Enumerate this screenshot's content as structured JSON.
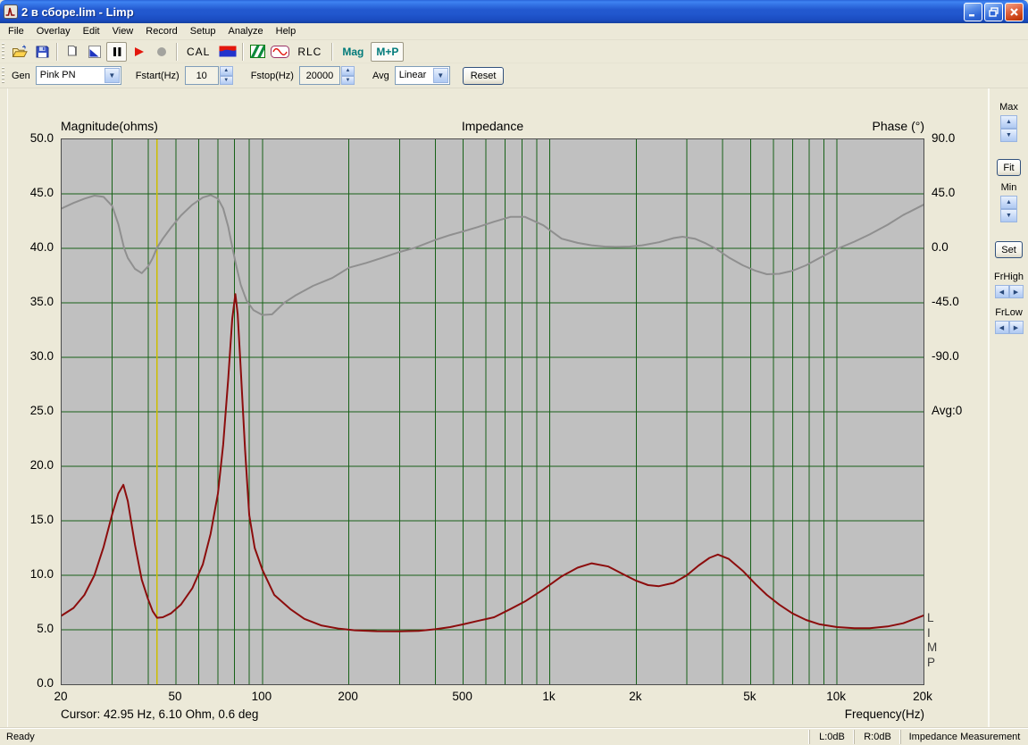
{
  "window": {
    "title": "2 в сборе.lim - Limp"
  },
  "menu": {
    "items": [
      "File",
      "Overlay",
      "Edit",
      "View",
      "Record",
      "Setup",
      "Analyze",
      "Help"
    ]
  },
  "toolbar": {
    "open": "open",
    "save": "save",
    "copy": "copy",
    "overlay_color": "overlay-color",
    "pause": "pause",
    "play": "play",
    "record": "record",
    "cal_label": "CAL",
    "rlc_label": "RLC",
    "mag_label": "Mag",
    "mp_label": "M+P"
  },
  "controls": {
    "gen_label": "Gen",
    "gen_value": "Pink PN",
    "fstart_label": "Fstart(Hz)",
    "fstart_value": "10",
    "fstop_label": "Fstop(Hz)",
    "fstop_value": "20000",
    "avg_label": "Avg",
    "avg_value": "Linear",
    "reset_label": "Reset"
  },
  "side_panel": {
    "max_label": "Max",
    "fit_label": "Fit",
    "min_label": "Min",
    "set_label": "Set",
    "frhigh_label": "FrHigh",
    "frlow_label": "FrLow"
  },
  "chart": {
    "title": "Impedance",
    "left_axis_title": "Magnitude(ohms)",
    "right_axis_title": "Phase (°)",
    "x_axis_title": "Frequency(Hz)",
    "cursor_text": "Cursor: 42.95 Hz, 6.10 Ohm, 0.6 deg",
    "avg_text": "Avg:0",
    "watermark": "L\nI\nM\nP"
  },
  "chart_data": {
    "type": "line",
    "title": "Impedance",
    "x_scale": "log",
    "x_range": [
      20,
      20000
    ],
    "mag_axis_range": [
      0,
      50
    ],
    "phase_axis_range_deg": [
      -90,
      90
    ],
    "phase_deg_per_division": 45,
    "mag_ohm_per_division": 5,
    "grid": {
      "v_freqs": [
        30,
        40,
        50,
        60,
        70,
        80,
        90,
        100,
        200,
        300,
        400,
        500,
        600,
        700,
        800,
        900,
        1000,
        2000,
        3000,
        4000,
        5000,
        6000,
        7000,
        8000,
        9000,
        10000
      ]
    },
    "left_tick_labels": [
      "50.0",
      "45.0",
      "40.0",
      "35.0",
      "30.0",
      "25.0",
      "20.0",
      "15.0",
      "10.0",
      "5.0",
      "0.0"
    ],
    "right_tick_labels": [
      "90.0",
      "45.0",
      "0.0",
      "-45.0",
      "-90.0"
    ],
    "x_ticks": [
      {
        "f": 20,
        "label": "20"
      },
      {
        "f": 50,
        "label": "50"
      },
      {
        "f": 100,
        "label": "100"
      },
      {
        "f": 200,
        "label": "200"
      },
      {
        "f": 500,
        "label": "500"
      },
      {
        "f": 1000,
        "label": "1k"
      },
      {
        "f": 2000,
        "label": "2k"
      },
      {
        "f": 5000,
        "label": "5k"
      },
      {
        "f": 10000,
        "label": "10k"
      },
      {
        "f": 20000,
        "label": "20k"
      }
    ],
    "cursor": {
      "freq_hz": 42.95,
      "magnitude_ohm": 6.1,
      "phase_deg": 0.6,
      "color": "#CDBE00"
    },
    "colors": {
      "plot_bg": "#C0C0C0",
      "grid": "#176117",
      "magnitude": "#8C0D0D",
      "phase": "#8F8F8F"
    },
    "series": [
      {
        "name": "Impedance magnitude (ohms)",
        "axis": "mag",
        "color": "#8C0D0D",
        "x": [
          20,
          22,
          24,
          26,
          28,
          30,
          31.5,
          32.8,
          34,
          36,
          38,
          40,
          41.5,
          43,
          45,
          48,
          52,
          57,
          62,
          66,
          70,
          73,
          76,
          78.5,
          80.5,
          82,
          84,
          87,
          90,
          94,
          100,
          110,
          125,
          140,
          160,
          185,
          210,
          250,
          300,
          350,
          400,
          450,
          500,
          560,
          640,
          730,
          820,
          950,
          1100,
          1250,
          1400,
          1600,
          1800,
          2000,
          2200,
          2400,
          2700,
          3000,
          3300,
          3600,
          3850,
          4200,
          4700,
          5200,
          5700,
          6300,
          7000,
          7800,
          8700,
          10000,
          11500,
          13000,
          15000,
          17000,
          20000
        ],
        "y": [
          6.3,
          7.0,
          8.2,
          10.0,
          12.6,
          15.6,
          17.5,
          18.3,
          16.8,
          12.8,
          9.6,
          7.8,
          6.7,
          6.1,
          6.15,
          6.5,
          7.3,
          8.8,
          11.0,
          13.8,
          17.5,
          22,
          28,
          33.5,
          35.8,
          34,
          29,
          21.5,
          15.5,
          12.5,
          10.5,
          8.2,
          6.9,
          6.0,
          5.4,
          5.1,
          4.95,
          4.87,
          4.85,
          4.9,
          5.05,
          5.25,
          5.5,
          5.8,
          6.15,
          6.9,
          7.6,
          8.7,
          9.9,
          10.7,
          11.1,
          10.8,
          10.1,
          9.5,
          9.1,
          9.0,
          9.3,
          10.0,
          10.9,
          11.6,
          11.9,
          11.5,
          10.4,
          9.2,
          8.2,
          7.3,
          6.5,
          5.9,
          5.5,
          5.25,
          5.15,
          5.15,
          5.3,
          5.6,
          6.3
        ]
      },
      {
        "name": "Phase (deg)",
        "axis": "phase",
        "color": "#8F8F8F",
        "x": [
          20,
          22,
          24,
          26,
          28,
          30,
          31.5,
          33,
          34,
          36,
          38,
          40,
          41.5,
          43,
          45,
          48,
          52,
          57,
          62,
          66,
          70,
          73,
          76,
          79,
          81,
          84,
          88,
          93,
          100,
          108,
          119,
          130,
          150,
          175,
          200,
          230,
          260,
          300,
          340,
          400,
          450,
          500,
          560,
          640,
          730,
          820,
          950,
          1100,
          1250,
          1400,
          1550,
          1700,
          1900,
          2100,
          2400,
          2700,
          2900,
          3200,
          3500,
          3800,
          4200,
          4700,
          5200,
          5700,
          6300,
          7000,
          7800,
          8700,
          10000,
          11500,
          13000,
          15000,
          17000,
          20000
        ],
        "y": [
          33,
          37.5,
          41,
          43.5,
          42.5,
          35,
          20,
          0,
          -8,
          -17,
          -20.5,
          -15,
          -8,
          0.6,
          8,
          17,
          27,
          36,
          42,
          44,
          41,
          33,
          18,
          -2,
          -14,
          -30,
          -43,
          -51,
          -55,
          -54.5,
          -45,
          -39,
          -31,
          -24.5,
          -16,
          -12,
          -8,
          -3,
          0.5,
          7,
          11,
          14,
          17.5,
          22,
          26,
          26,
          19,
          8,
          4.5,
          2.5,
          1.5,
          1.2,
          1.5,
          2.5,
          5,
          8.5,
          9.6,
          8,
          4,
          -0.5,
          -7.5,
          -14,
          -18.5,
          -21.4,
          -21,
          -18.5,
          -14,
          -8,
          -0.5,
          5.5,
          11.5,
          19.5,
          27.5,
          36
        ]
      }
    ]
  },
  "statusbar": {
    "ready": "Ready",
    "l_level": "L:0dB",
    "r_level": "R:0dB",
    "mode": "Impedance Measurement"
  }
}
